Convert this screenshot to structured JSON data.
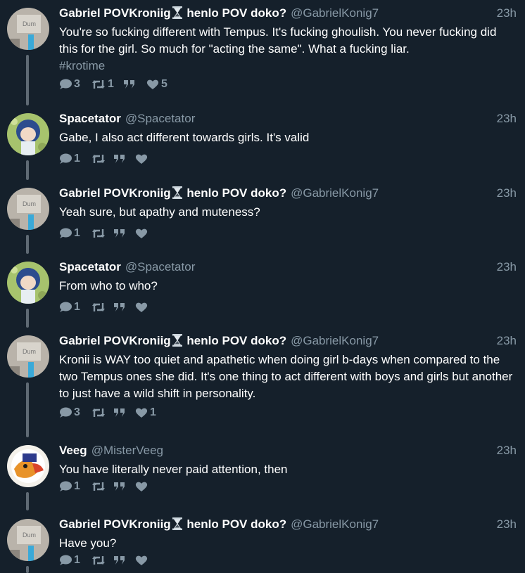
{
  "colors": {
    "background": "#15202b",
    "text": "#ffffff",
    "muted": "#8899a6",
    "thread_line": "#5f6a74"
  },
  "icons": {
    "reply": "speech-bubble-icon",
    "retweet": "retweet-arrows-icon",
    "quote": "quote-marks-icon",
    "like": "heart-icon",
    "name_emoji": "hourglass-icon"
  },
  "tweets": [
    {
      "name_part1": "Gabriel POVKroniig",
      "name_part2": " henlo POV doko?",
      "handle": "@GabrielKonig7",
      "time": "23h",
      "text": "You're so fucking different with Tempus. It's fucking ghoulish. You never fucking did this for the girl. So much for \"acting the same\". What a fucking liar.",
      "hashtag": "#krotime",
      "replies": "3",
      "retweets": "1",
      "likes": "5"
    },
    {
      "name": "Spacetator",
      "handle": "@Spacetator",
      "time": "23h",
      "text": "Gabe, I also act different towards girls. It's valid",
      "replies": "1",
      "retweets": "",
      "likes": ""
    },
    {
      "name_part1": "Gabriel POVKroniig",
      "name_part2": " henlo POV doko?",
      "handle": "@GabrielKonig7",
      "time": "23h",
      "text": "Yeah sure, but apathy and muteness?",
      "replies": "1",
      "retweets": "",
      "likes": ""
    },
    {
      "name": "Spacetator",
      "handle": "@Spacetator",
      "time": "23h",
      "text": "From who to who?",
      "replies": "1",
      "retweets": "",
      "likes": ""
    },
    {
      "name_part1": "Gabriel POVKroniig",
      "name_part2": " henlo POV doko?",
      "handle": "@GabrielKonig7",
      "time": "23h",
      "text": "Kronii is WAY too quiet and apathetic when doing girl b-days when compared to the two Tempus ones she did. It's one thing to act different with boys and girls but another to just have a wild shift in personality.",
      "replies": "3",
      "retweets": "",
      "likes": "1"
    },
    {
      "name": "Veeg",
      "handle": "@MisterVeeg",
      "time": "23h",
      "text": "You have literally never paid attention, then",
      "replies": "1",
      "retweets": "",
      "likes": ""
    },
    {
      "name_part1": "Gabriel POVKroniig",
      "name_part2": " henlo POV doko?",
      "handle": "@GabrielKonig7",
      "time": "23h",
      "text": "Have you?",
      "replies": "1",
      "retweets": "",
      "likes": ""
    }
  ]
}
